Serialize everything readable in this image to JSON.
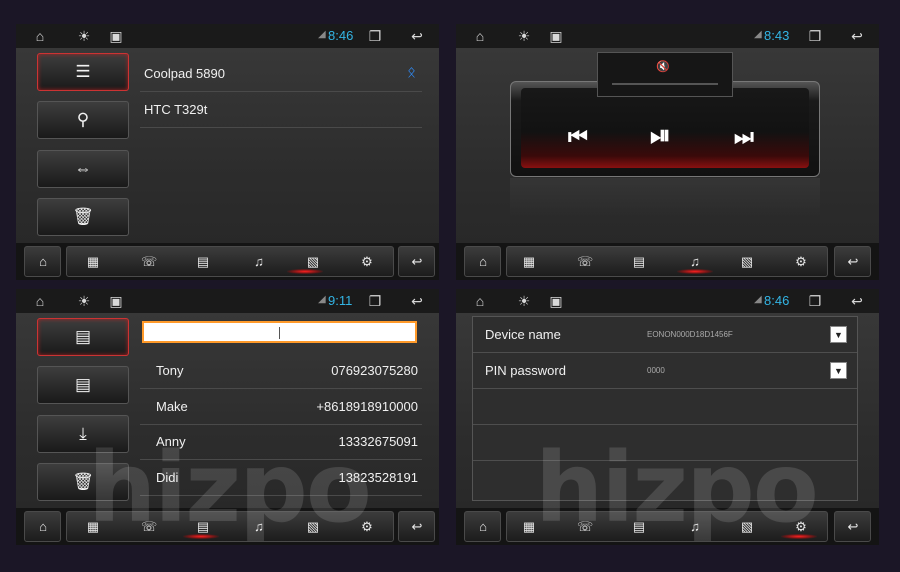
{
  "panels": {
    "bluetooth_devices": {
      "time": "8:46",
      "devices": [
        {
          "name": "Coolpad 5890",
          "connected": true
        },
        {
          "name": "HTC T329t"
        }
      ]
    },
    "music_player": {
      "time": "8:43"
    },
    "phonebook": {
      "time": "9:11",
      "search_value": "",
      "contacts": [
        {
          "name": "Tony",
          "number": "076923075280"
        },
        {
          "name": "Make",
          "number": "+8618918910000"
        },
        {
          "name": "Anny",
          "number": "13332675091"
        },
        {
          "name": "Didi",
          "number": "13823528191"
        }
      ]
    },
    "settings": {
      "time": "8:46",
      "rows": [
        {
          "label": "Device name",
          "value": "EONON000D18D1456F"
        },
        {
          "label": "PIN password",
          "value": "0000"
        }
      ]
    }
  },
  "icons": {
    "status": [
      "home-icon",
      "brightness-icon",
      "gallery-icon",
      "signal-icon",
      "recent-apps-icon",
      "back-icon"
    ],
    "bottom": [
      "home-icon",
      "dialpad-icon",
      "call-log-icon",
      "contacts-icon",
      "music-icon",
      "bt-device-icon",
      "settings-icon",
      "back-icon"
    ]
  },
  "watermark": "hizpo",
  "colors": {
    "accent_time": "#33b5e5",
    "active_red": "#ff2020",
    "bluetooth": "#2f8fff",
    "search_border": "#ff9a2a"
  }
}
